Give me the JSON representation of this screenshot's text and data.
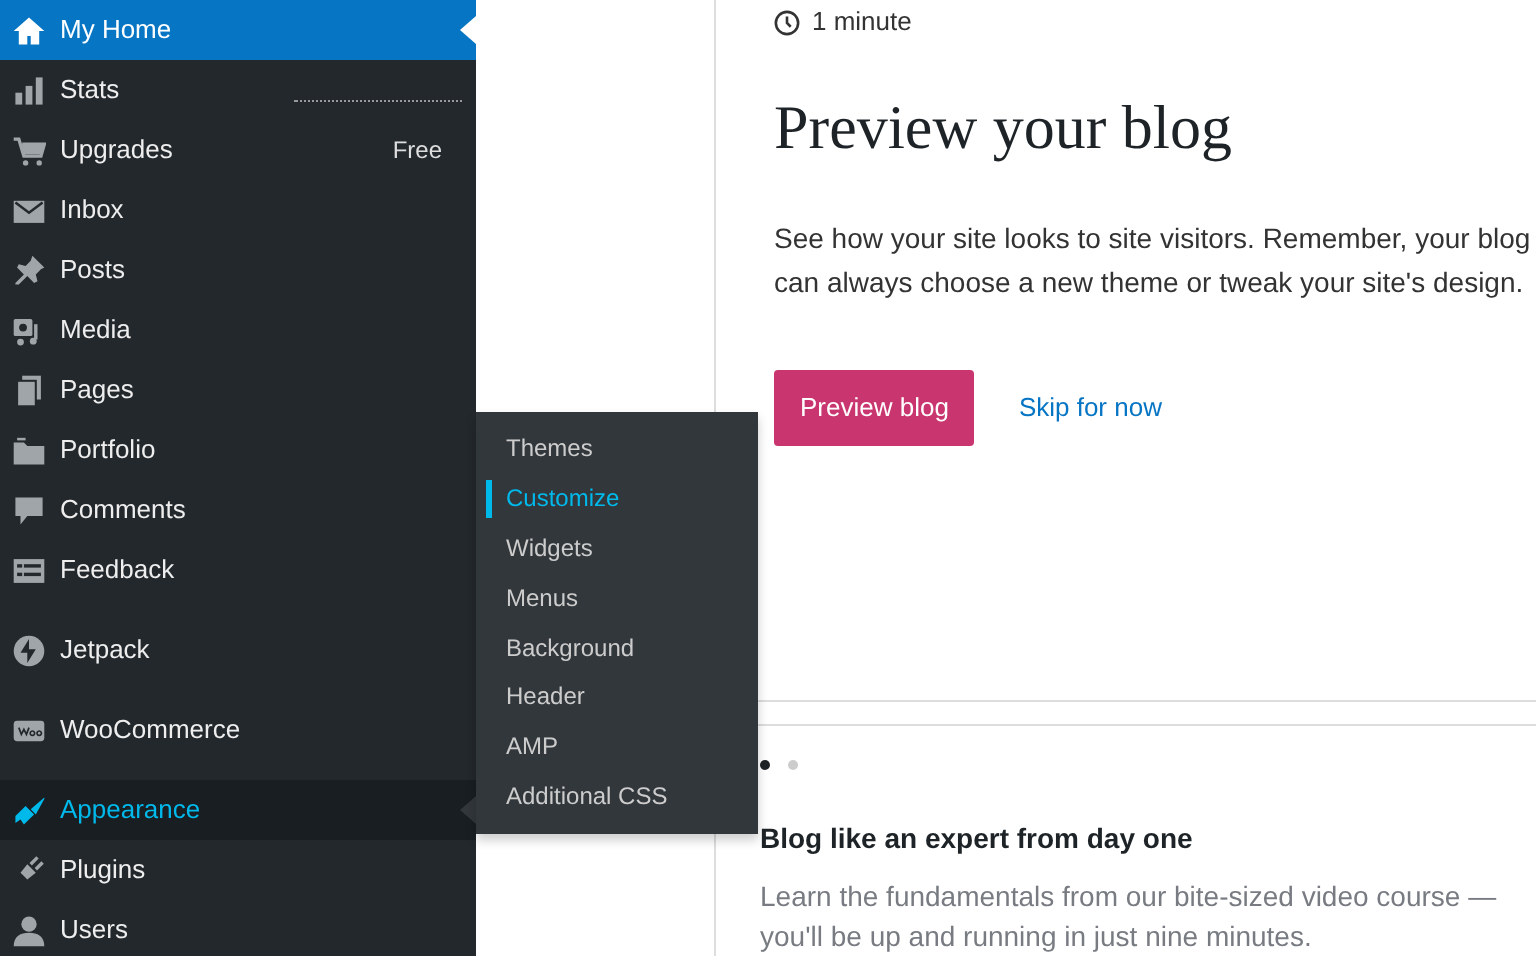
{
  "sidebar": {
    "groups": [
      [
        {
          "label": "My Home",
          "selected": true
        },
        {
          "label": "Stats",
          "selected": false
        },
        {
          "label": "Upgrades",
          "selected": false,
          "badge": "Free"
        },
        {
          "label": "Inbox",
          "selected": false
        },
        {
          "label": "Posts",
          "selected": false
        },
        {
          "label": "Media",
          "selected": false
        },
        {
          "label": "Pages",
          "selected": false
        },
        {
          "label": "Portfolio",
          "selected": false
        },
        {
          "label": "Comments",
          "selected": false
        },
        {
          "label": "Feedback",
          "selected": false
        }
      ],
      [
        {
          "label": "Jetpack",
          "selected": false
        }
      ],
      [
        {
          "label": "WooCommerce",
          "selected": false
        }
      ],
      [
        {
          "label": "Appearance",
          "selected": false,
          "expanded": true
        },
        {
          "label": "Plugins",
          "selected": false
        },
        {
          "label": "Users",
          "selected": false
        }
      ]
    ]
  },
  "flyout": {
    "items": [
      {
        "label": "Themes",
        "selected": false
      },
      {
        "label": "Customize",
        "selected": true
      },
      {
        "label": "Widgets",
        "selected": false
      },
      {
        "label": "Menus",
        "selected": false
      },
      {
        "label": "Background",
        "selected": false
      },
      {
        "label": "Header",
        "selected": false
      },
      {
        "label": "AMP",
        "selected": false
      },
      {
        "label": "Additional CSS",
        "selected": false
      }
    ]
  },
  "task_card": {
    "duration": "1 minute",
    "title": "Preview your blog",
    "text": "See how your site looks to site visitors. Remember, your blog can always choose a new theme or tweak your site's design.",
    "primary_button": "Preview blog",
    "secondary_link": "Skip for now"
  },
  "course_card": {
    "pager": [
      {
        "selected": true
      },
      {
        "selected": false
      }
    ],
    "title": "Blog like an expert from day one",
    "text": "Learn the fundamentals from our bite-sized video course — you'll be up and running in just nine minutes."
  }
}
